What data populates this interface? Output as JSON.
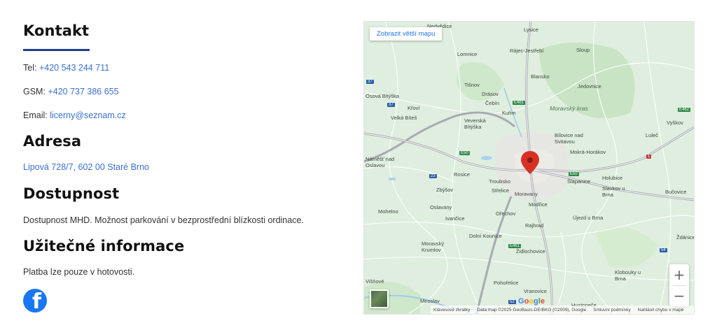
{
  "kontakt": {
    "title": "Kontakt",
    "tel_label": "Tel:",
    "tel_value": "+420 543 244 711",
    "gsm_label": "GSM:",
    "gsm_value": "+420 737 386 655",
    "email_label": "Email:",
    "email_value": "licerny@seznam.cz"
  },
  "adresa": {
    "title": "Adresa",
    "value": "Lipová 728/7, 602 00 Staré Brno"
  },
  "dostupnost": {
    "title": "Dostupnost",
    "text": "Dostupnost MHD. Možnost parkování v bezprostřední blízkosti ordinace."
  },
  "uzitecne": {
    "title": "Užitečné informace",
    "text": "Platba lze pouze v hotovosti."
  },
  "social": {
    "facebook_glyph": "f",
    "brand_color": "#1877f2"
  },
  "map": {
    "bigger_map_button": "Zobrazit větší mapu",
    "zoom_in": "+",
    "zoom_out": "−",
    "google_letters": [
      "G",
      "o",
      "o",
      "g",
      "l",
      "e"
    ],
    "footer": {
      "shortcuts": "Klávesové zkratky",
      "data": "Data map ©2025 GeoBasis-DE/BKG (©2009), Google",
      "terms": "Smluvní podmínky",
      "report": "Nahlásit chybu v mapě"
    },
    "places": [
      "Nedvědice",
      "Lysice",
      "Rájec-Jestřebí",
      "Sloup",
      "Lomnice",
      "Blansko",
      "Jedovnice",
      "Tišnov",
      "Drásov",
      "Čebín",
      "Moravský kras",
      "Kuřim",
      "Osová Bitýška",
      "Křoví",
      "Velká Bíteš",
      "Veverská Bítýška",
      "Bílovice nad Svitavou",
      "Lulеč",
      "Vyškov",
      "Mokrá-Horákov",
      "Náměšť nad Oslavou",
      "Rosice",
      "Troubsko",
      "Šlapanice",
      "Holubice",
      "Zbýšov",
      "Střelice",
      "Moravany",
      "Slavkov u Brna",
      "Bučovice",
      "Oslavany",
      "Modřice",
      "Mohelno",
      "Ořechov",
      "Ivančice",
      "Újezd u Brna",
      "Rajhrad",
      "Dolní Kounice",
      "Moravský Krumlov",
      "Židlochovice",
      "Ždánice",
      "Klobouky u Brna",
      "Višňové",
      "Pohořelice",
      "Vranovice",
      "Miroslav",
      "Hustopeče"
    ],
    "roads": [
      "E461",
      "37",
      "37",
      "E462",
      "E50",
      "E50",
      "E461",
      "52",
      "54",
      "1",
      "23"
    ],
    "marker_color": "#d93025"
  }
}
